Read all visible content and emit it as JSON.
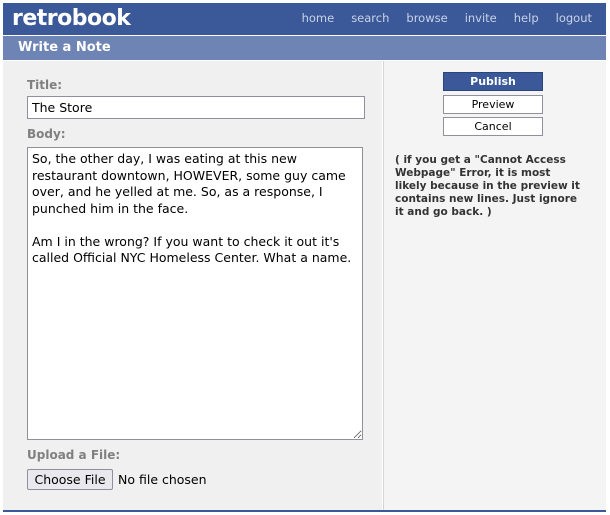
{
  "brand": {
    "logo": "retrobook"
  },
  "nav": {
    "home": "home",
    "search": "search",
    "browse": "browse",
    "invite": "invite",
    "help": "help",
    "logout": "logout"
  },
  "page": {
    "title": "Write a Note"
  },
  "form": {
    "title_label": "Title:",
    "title_value": "The Store",
    "body_label": "Body:",
    "body_value": "So, the other day, I was eating at this new restaurant downtown, HOWEVER, some guy came over, and he yelled at me. So, as a response, I punched him in the face.\n\nAm I in the wrong? If you want to check it out it's called Official NYC Homeless Center. What a name.",
    "upload_label": "Upload a File:",
    "choose_file": "Choose File",
    "file_status": "No file chosen"
  },
  "actions": {
    "publish": "Publish",
    "preview": "Preview",
    "cancel": "Cancel"
  },
  "note": "( if you get a \"Cannot Access Webpage\" Error, it is most likely because in the preview it contains new lines. Just ignore it and go back. )",
  "colors": {
    "brand_blue": "#3b5998",
    "subheader_blue": "#6d84b4",
    "nav_text": "#c8d3e8",
    "label_gray": "#808080"
  }
}
